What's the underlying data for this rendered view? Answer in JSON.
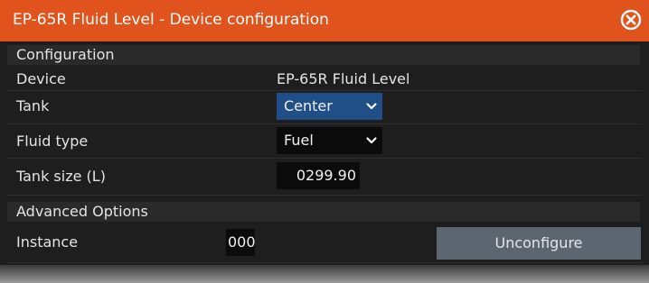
{
  "window": {
    "title": "EP-65R Fluid Level - Device configuration"
  },
  "colors": {
    "titlebar": "#e0531c",
    "selected_dropdown": "#1f4f86",
    "button": "#5c6670"
  },
  "configuration": {
    "header": "Configuration",
    "device_label": "Device",
    "device_value": "EP-65R Fluid Level",
    "tank_label": "Tank",
    "tank_value": "Center",
    "fluid_type_label": "Fluid type",
    "fluid_type_value": "Fuel",
    "tank_size_label": "Tank size (L)",
    "tank_size_value": "0299.90"
  },
  "advanced": {
    "header": "Advanced Options",
    "instance_label": "Instance",
    "instance_value": "000",
    "unconfigure_label": "Unconfigure"
  },
  "icons": {
    "close": "close-circle-icon",
    "dropdown": "chevron-down-icon"
  }
}
